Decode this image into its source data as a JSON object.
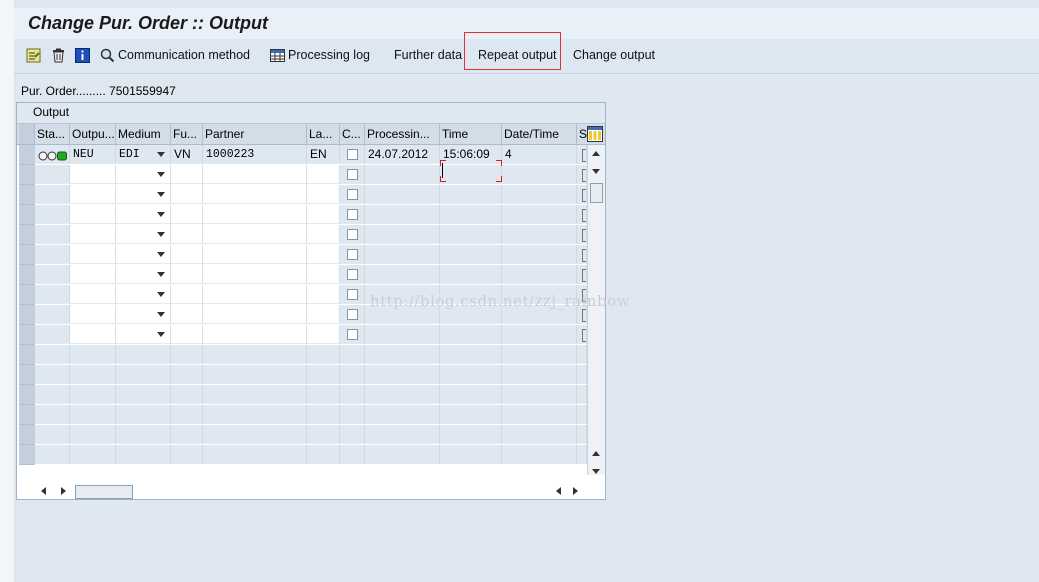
{
  "window": {
    "title": "Change Pur. Order :: Output"
  },
  "toolbar": {
    "communication_method": "Communication method",
    "processing_log": "Processing log",
    "further_data": "Further data",
    "repeat_output": "Repeat output",
    "change_output": "Change output"
  },
  "header": {
    "label": "Pur. Order.........",
    "value": "7501559947"
  },
  "output_panel": {
    "title": "Output",
    "columns": [
      "Sta...",
      "Outpu...",
      "Medium",
      "Fu...",
      "Partner",
      "La...",
      "C...",
      "Processin...",
      "Time",
      "Date/Time",
      "S"
    ],
    "rows": [
      {
        "status": "",
        "output": "NEU",
        "medium": "EDI",
        "function": "VN",
        "partner": "1000223",
        "language": "EN",
        "changed": false,
        "processing_date": "24.07.2012",
        "time": "15:06:09",
        "date_time": "4"
      }
    ]
  },
  "watermark": "http://blog.csdn.net/zzj_rainbow",
  "colors": {
    "status_green": "#22aa22",
    "highlight_box": "#e03030"
  }
}
